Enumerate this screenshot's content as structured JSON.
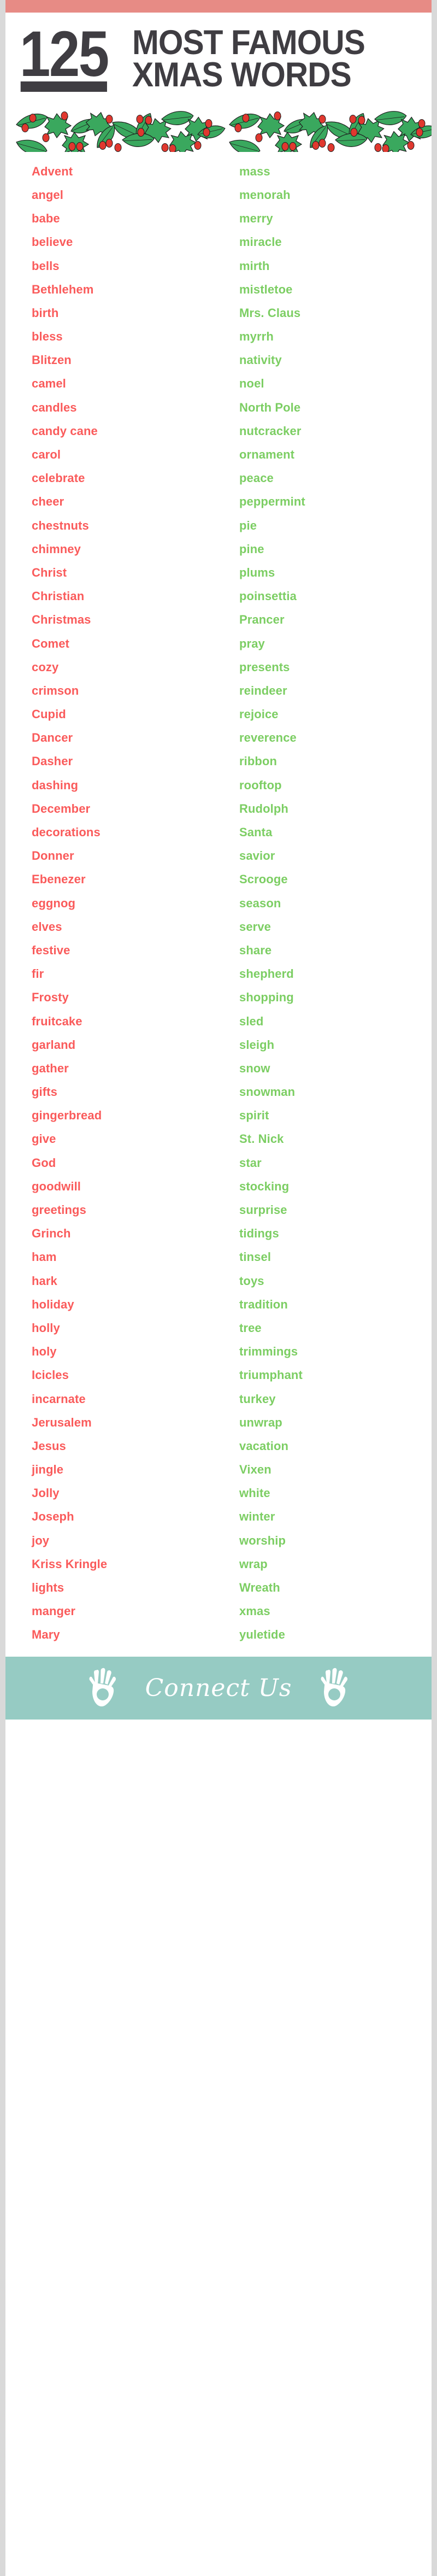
{
  "theme": {
    "top_bar_color": "#e78b85",
    "page_bg": "#ffffff",
    "outer_bg": "#d9d9d9",
    "left_word_color": "#fa5b5b",
    "right_word_color": "#7cce63",
    "heading_color": "#3f3d42",
    "footer_bg": "#96cbc3",
    "footer_text_color": "#ffffff",
    "holly_leaf_color": "#3aa85e",
    "holly_berry_color": "#e0382f"
  },
  "header": {
    "number": "125",
    "title_line1": "MOST FAMOUS",
    "title_line2": "XMAS WORDS"
  },
  "divider": {
    "icon": "holly-leaves-and-berries-border"
  },
  "words": {
    "left_column": [
      "Advent",
      "angel",
      "babe",
      "believe",
      "bells",
      "Bethlehem",
      "birth",
      "bless",
      "Blitzen",
      "camel",
      "candles",
      "candy cane",
      "carol",
      "celebrate",
      "cheer",
      "chestnuts",
      "chimney",
      "Christ",
      "Christian",
      "Christmas",
      "Comet",
      "cozy",
      "crimson",
      "Cupid",
      "Dancer",
      "Dasher",
      "dashing",
      "December",
      "decorations",
      "Donner",
      "Ebenezer",
      "eggnog",
      "elves",
      "festive",
      "fir",
      "Frosty",
      "fruitcake",
      "garland",
      "gather",
      "gifts",
      "gingerbread",
      "give",
      "God",
      "goodwill",
      "greetings",
      "Grinch",
      "ham",
      "hark",
      "holiday",
      "holly",
      "holy",
      "Icicles",
      "incarnate",
      "Jerusalem",
      "Jesus",
      "jingle",
      "Jolly",
      "Joseph",
      "joy",
      "Kriss Kringle",
      "lights",
      "manger",
      "Mary"
    ],
    "right_column": [
      "mass",
      "menorah",
      "merry",
      "miracle",
      "mirth",
      "mistletoe",
      "Mrs. Claus",
      "myrrh",
      "nativity",
      "noel",
      "North Pole",
      "nutcracker",
      "ornament",
      "peace",
      "peppermint",
      "pie",
      "pine",
      "plums",
      "poinsettia",
      "Prancer",
      "pray",
      "presents",
      "reindeer",
      "rejoice",
      "reverence",
      "ribbon",
      "rooftop",
      "Rudolph",
      "Santa",
      "savior",
      "Scrooge",
      "season",
      "serve",
      "share",
      "shepherd",
      "shopping",
      "sled",
      "sleigh",
      "snow",
      "snowman",
      "spirit",
      "St. Nick",
      "star",
      "stocking",
      "surprise",
      "tidings",
      "tinsel",
      "toys",
      "tradition",
      "tree",
      "trimmings",
      "triumphant",
      "turkey",
      "unwrap",
      "vacation",
      "Vixen",
      "white",
      "winter",
      "worship",
      "wrap",
      "Wreath",
      "xmas",
      "yuletide"
    ]
  },
  "footer": {
    "label": "Connect Us",
    "left_icon": "open-hand-icon",
    "right_icon": "open-hand-icon"
  }
}
